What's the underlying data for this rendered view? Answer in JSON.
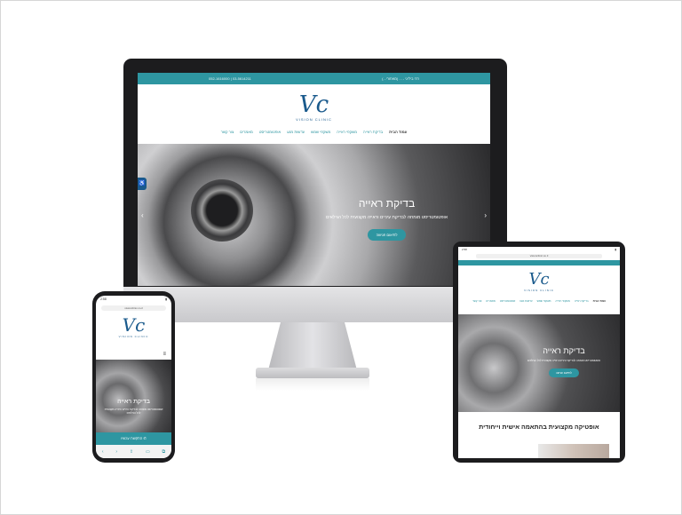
{
  "desktop": {
    "topbar": {
      "right_text": "רח' ביליגי - ... (מאחורי...)",
      "phone_text": "052-1616000 | 03-5614211"
    },
    "logo": {
      "mark": "Vc",
      "text": "VISION CLINIC"
    },
    "menu": [
      "עמוד הבית",
      "בדיקת ראייה",
      "משקפי ראייה",
      "משקפי שמש",
      "עדשות מגע",
      "אופטומטריסט",
      "מאמרים",
      "צור קשר"
    ],
    "hero": {
      "title": "בדיקת ראייה",
      "subtitle": "אופטומטריסט מומחה לבדיקת עיניים וראייה מקצועית לכל הגילאים",
      "button": "לתיאום פגישה"
    }
  },
  "phone": {
    "time": "2:58",
    "url": "visionclinic.co.il",
    "logo": {
      "mark": "Vc",
      "text": "VISION CLINIC"
    },
    "hero": {
      "title": "בדיקת ראייה",
      "subtitle": "אופטומטריסט מומחה לבדיקת עיניים וראייה מקצועית לכל הגילאים"
    },
    "cta": "התקשרו עכשיו"
  },
  "tablet": {
    "time": "2:58",
    "url": "visionclinic.co.il",
    "logo": {
      "mark": "Vc",
      "text": "VISION CLINIC"
    },
    "menu": [
      "עמוד הבית",
      "בדיקת ראייה",
      "משקפי ראייה",
      "משקפי שמש",
      "עדשות מגע",
      "אופטומטריסט",
      "מאמרים",
      "צור קשר"
    ],
    "hero": {
      "title": "בדיקת ראייה",
      "subtitle": "אופטומטריסט מומחה לבדיקת עיניים וראייה מקצועית לכל הגילאים",
      "button": "לתיאום פגישה"
    },
    "section_title": "אופטיקה מקצועית בהתאמה אישית וייחודית"
  },
  "colors": {
    "accent": "#2e96a1",
    "logo": "#1a5a8c",
    "device": "#1c1c1e"
  }
}
